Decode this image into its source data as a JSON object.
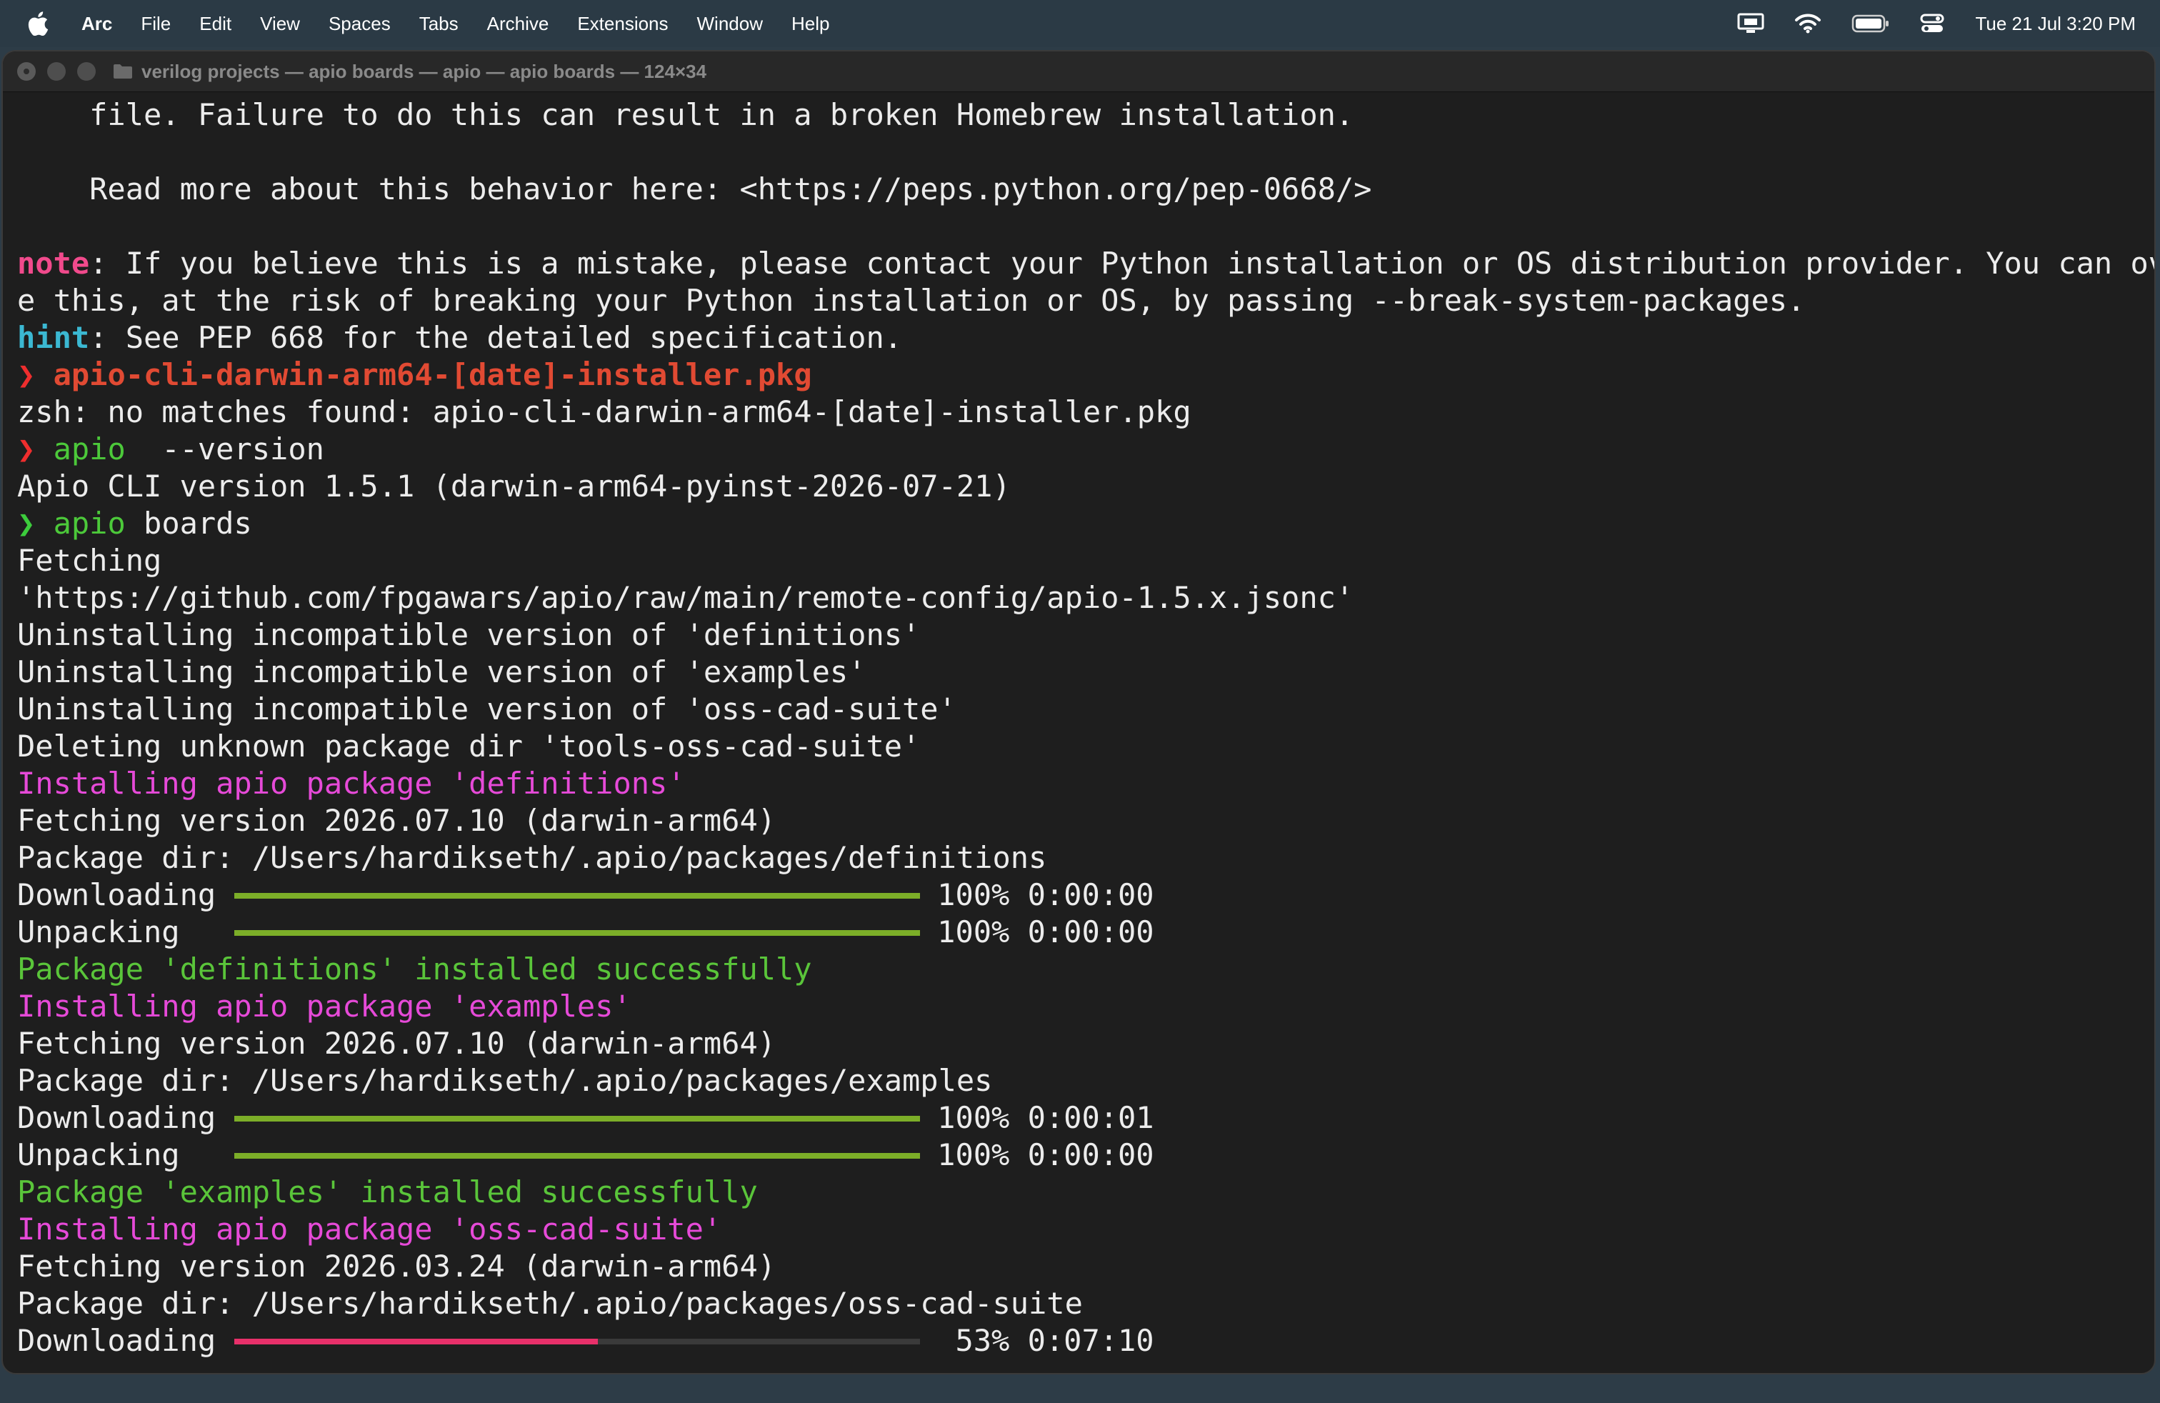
{
  "menubar": {
    "app": "Arc",
    "items": [
      "File",
      "Edit",
      "View",
      "Spaces",
      "Tabs",
      "Archive",
      "Extensions",
      "Window",
      "Help"
    ],
    "clock": "Tue 21 Jul  3:20 PM",
    "status_icons": [
      "display-icon",
      "wifi-icon",
      "battery-icon",
      "control-center-icon"
    ]
  },
  "window": {
    "title": "verilog projects — apio boards — apio — apio boards — 124×34"
  },
  "terminal": {
    "l1": "    file. Failure to do this can result in a broken Homebrew installation.",
    "l2": "    Read more about this behavior here: <https://peps.python.org/pep-0668/>",
    "note_label": "note",
    "note_text": ": If you believe this is a mistake, please contact your Python installation or OS distribution provider. You can overrid",
    "note_cont": "e this, at the risk of breaking your Python installation or OS, by passing --break-system-packages.",
    "hint_label": "hint",
    "hint_text": ": See PEP 668 for the detailed specification.",
    "prompt_symbol": "❯",
    "cmd1": "apio-cli-darwin-arm64-[date]-installer.pkg",
    "err1": "zsh: no matches found: apio-cli-darwin-arm64-[date]-installer.pkg",
    "cmd2_name": "apio",
    "cmd2_args": "  --version",
    "out2": "Apio CLI version 1.5.1 (darwin-arm64-pyinst-2026-07-21)",
    "cmd3_name": "apio",
    "cmd3_args": " boards",
    "o1": "Fetching",
    "o2": "'https://github.com/fpgawars/apio/raw/main/remote-config/apio-1.5.x.jsonc'",
    "o3": "Uninstalling incompatible version of 'definitions'",
    "o4": "Uninstalling incompatible version of 'examples'",
    "o5": "Uninstalling incompatible version of 'oss-cad-suite'",
    "o6": "Deleting unknown package dir 'tools-oss-cad-suite'",
    "p1_install": "Installing apio package 'definitions'",
    "p1_fetch": "Fetching version 2026.07.10 (darwin-arm64)",
    "p1_dir": "Package dir: /Users/hardikseth/.apio/packages/definitions",
    "p1_dl_label": "Downloading",
    "p1_dl_stat": "100% 0:00:00",
    "p1_up_label": "Unpacking  ",
    "p1_up_stat": "100% 0:00:00",
    "p1_ok": "Package 'definitions' installed successfully",
    "p2_install": "Installing apio package 'examples'",
    "p2_fetch": "Fetching version 2026.07.10 (darwin-arm64)",
    "p2_dir": "Package dir: /Users/hardikseth/.apio/packages/examples",
    "p2_dl_label": "Downloading",
    "p2_dl_stat": "100% 0:00:01",
    "p2_up_label": "Unpacking  ",
    "p2_up_stat": "100% 0:00:00",
    "p2_ok": "Package 'examples' installed successfully",
    "p3_install": "Installing apio package 'oss-cad-suite'",
    "p3_fetch": "Fetching version 2026.03.24 (darwin-arm64)",
    "p3_dir": "Package dir: /Users/hardikseth/.apio/packages/oss-cad-suite",
    "p3_dl_label": "Downloading",
    "p3_dl_stat": " 53% 0:07:10"
  },
  "progress": {
    "p1_download": 1.0,
    "p1_unpack": 1.0,
    "p2_download": 1.0,
    "p2_unpack": 1.0,
    "p3_download": 0.53
  },
  "colors": {
    "progress_done": "#7cae28",
    "progress_active": "#e8306a",
    "installing": "#e64ad8",
    "success": "#4cc93a"
  }
}
